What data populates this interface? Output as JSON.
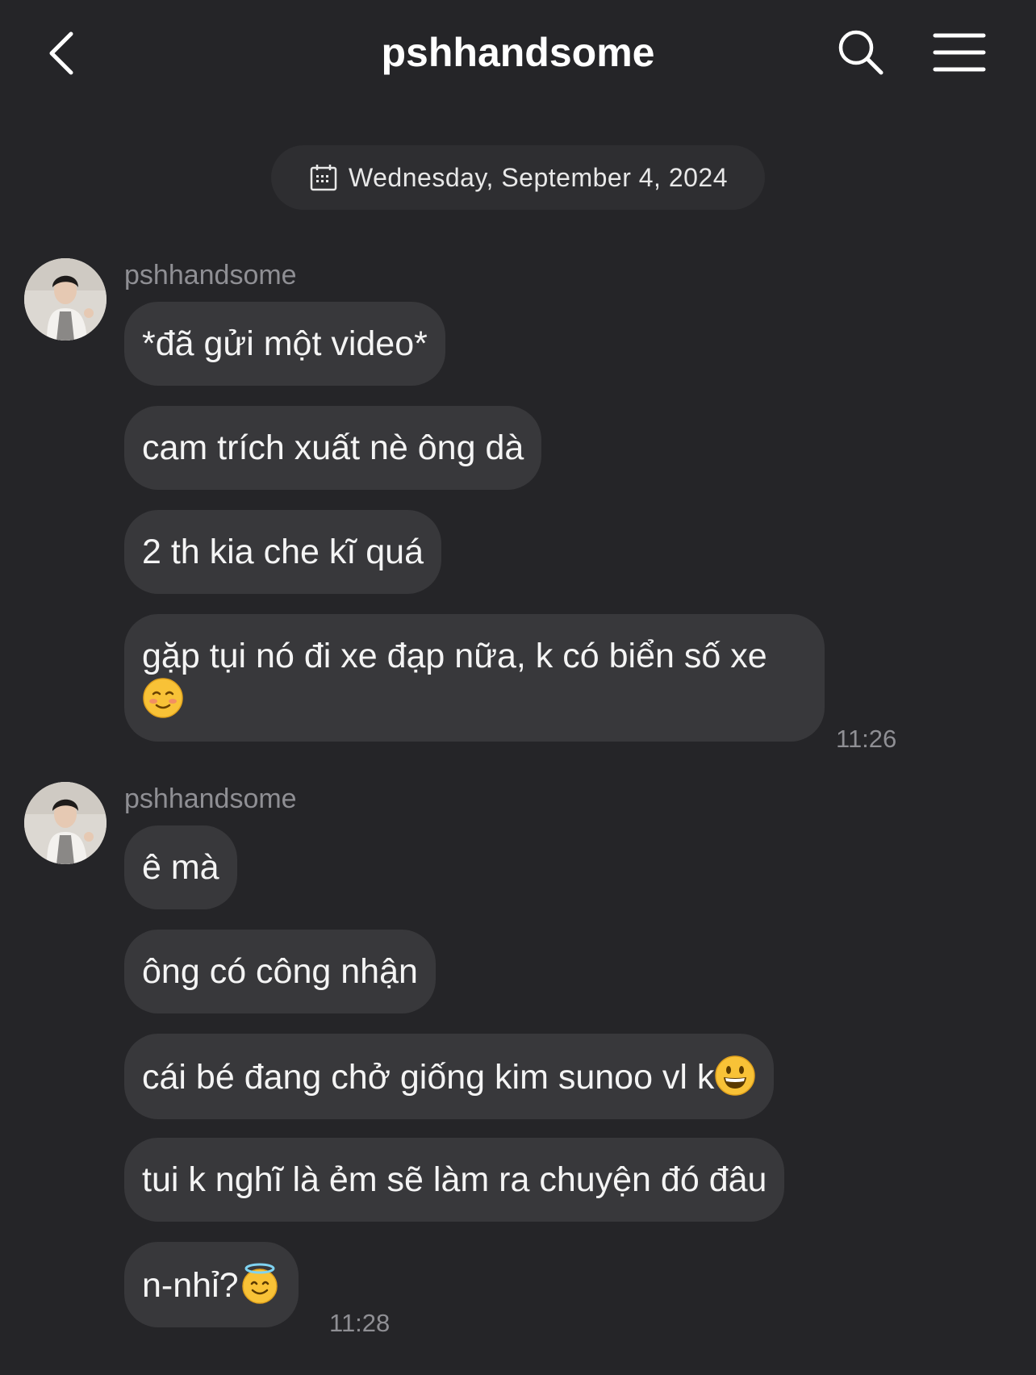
{
  "header": {
    "title": "pshhandsome",
    "icons": {
      "back": "chevron-left-icon",
      "search": "search-icon",
      "menu": "hamburger-menu-icon"
    }
  },
  "date_separator": "Wednesday, September 4, 2024",
  "groups": [
    {
      "sender": "pshhandsome",
      "messages": [
        "*đã gửi một video*",
        "cam trích xuất nè ông dà",
        "2 th kia che kĩ quá",
        "gặp tụi nó đi xe đạp nữa, k có biển số xe"
      ],
      "time": "11:26"
    },
    {
      "sender": "pshhandsome",
      "messages": [
        "ê mà",
        "ông có công nhận",
        "cái bé đang chở giống kim sunoo vl k",
        "tui k nghĩ là ẻm sẽ làm ra chuyện đó đâu",
        "n-nhỉ?"
      ],
      "time": "11:28"
    }
  ],
  "colors": {
    "background": "#252528",
    "bubble": "#38383b",
    "muted_text": "#8f8f94"
  }
}
